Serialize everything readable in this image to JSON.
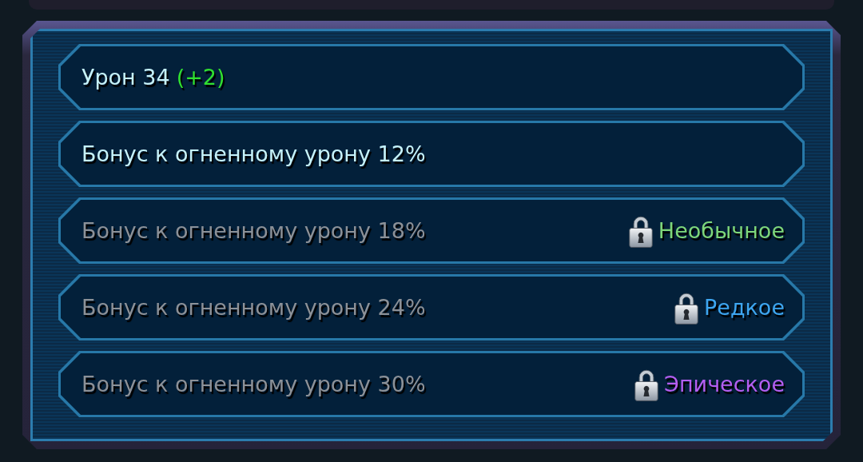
{
  "stats": [
    {
      "text": "Урон 34",
      "bonus": "(+2)",
      "locked": false
    },
    {
      "text": "Бонус к огненному урону 12%",
      "locked": false
    },
    {
      "text": "Бонус к огненному урону 18%",
      "locked": true,
      "rarity": {
        "label": "Необычное",
        "color": "#7ed67a"
      }
    },
    {
      "text": "Бонус к огненному урону 24%",
      "locked": true,
      "rarity": {
        "label": "Редкое",
        "color": "#3ea6f0"
      }
    },
    {
      "text": "Бонус к огненному урону 30%",
      "locked": true,
      "rarity": {
        "label": "Эпическое",
        "color": "#b45ef0"
      }
    }
  ]
}
